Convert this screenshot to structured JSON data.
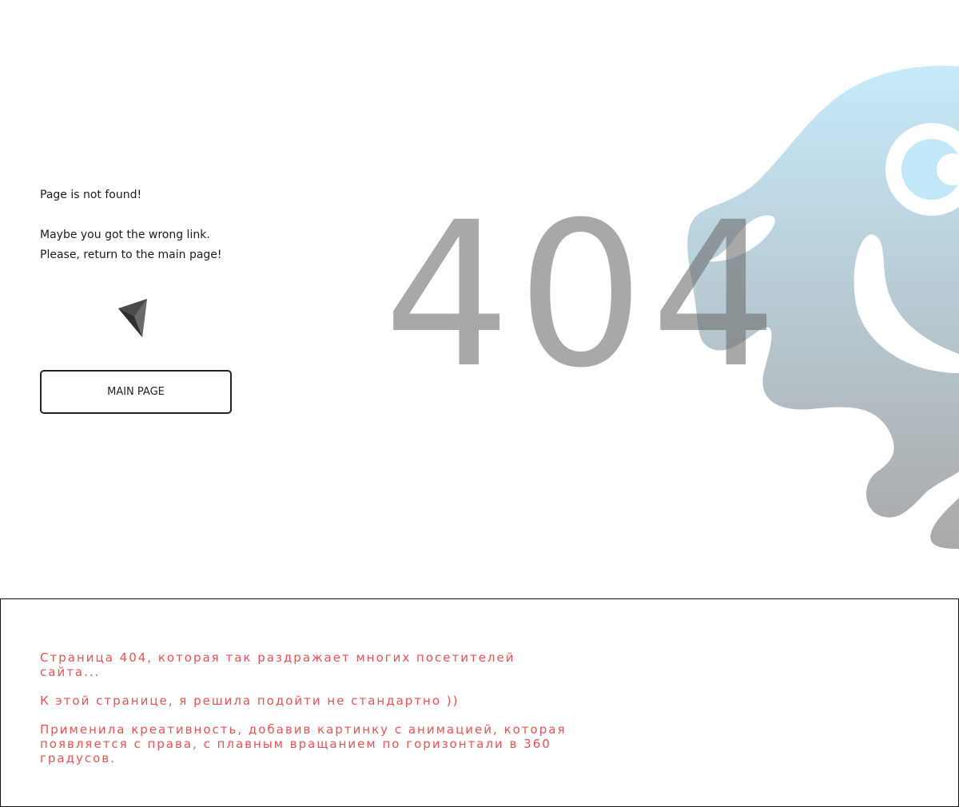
{
  "hero": {
    "title": "Page is not found!",
    "message_line1": "Maybe you got the wrong link.",
    "message_line2": "Please, return to the main page!",
    "icon": "paper-plane-icon",
    "button_label": "MAIN PAGE",
    "error_code": "404",
    "illustration": "octopus-blob-illustration"
  },
  "info": {
    "line1": "Страница 404, которая так раздражает многих посетителей сайта...",
    "line2": "К этой странице, я решила подойти не стандартно ))",
    "line3": "Применила креативность, добавив картинку с анимацией, которая появляется с права, с плавным вращанием по горизонтали в 360 градусов."
  },
  "colors": {
    "info_text": "#e55353",
    "blob_top": "#c6eafb",
    "blob_bottom": "#a9a9a9",
    "code": "#6e6e6e"
  }
}
